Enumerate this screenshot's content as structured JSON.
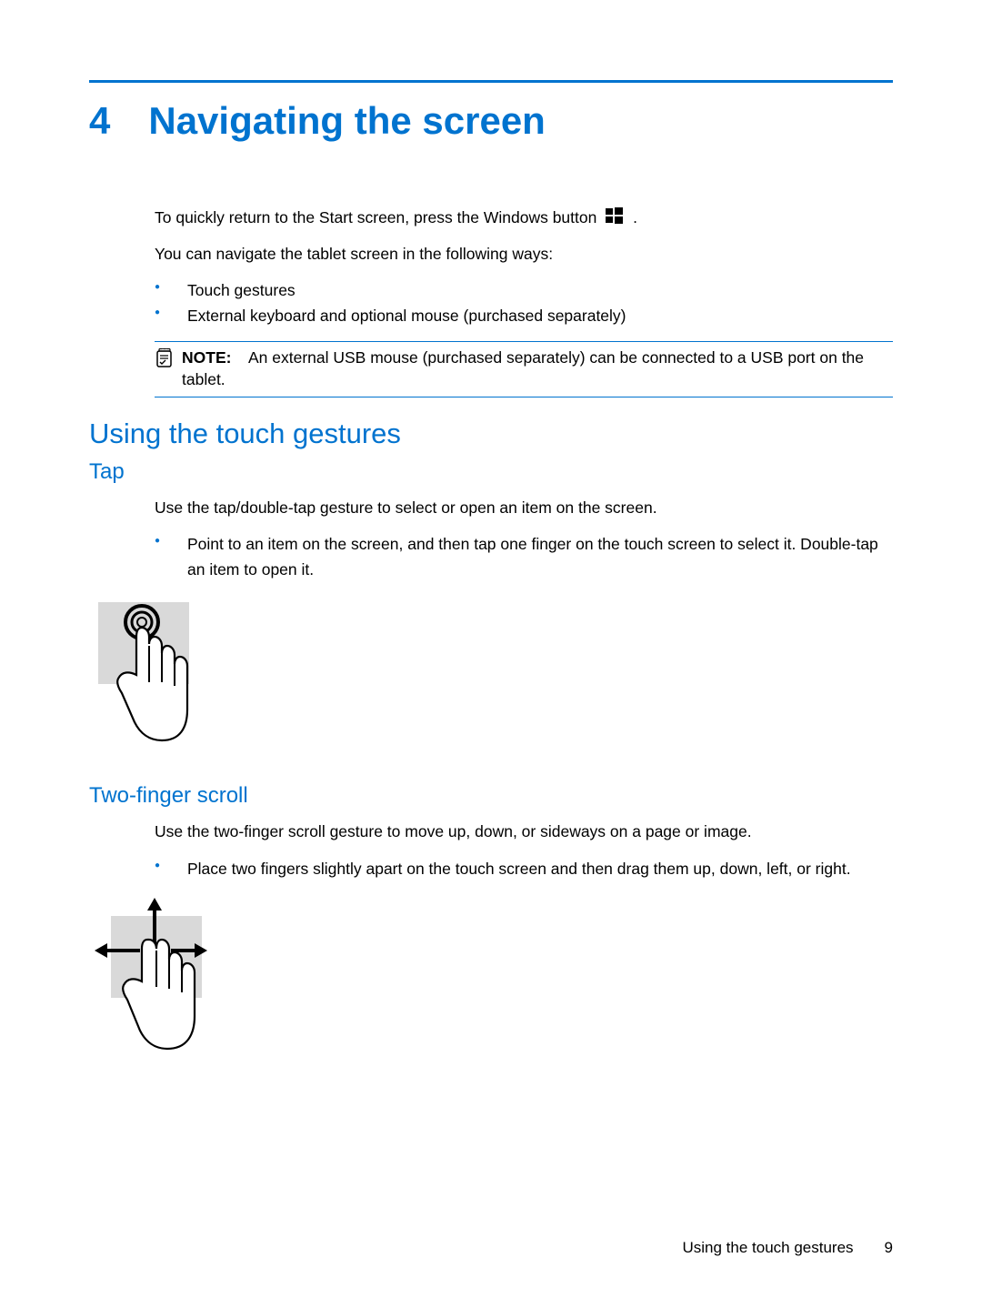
{
  "chapter": {
    "number": "4",
    "title": "Navigating the screen"
  },
  "intro": {
    "p1_pre": "To quickly return to the Start screen, press the Windows button",
    "p1_post": ".",
    "p2": "You can navigate the tablet screen in the following ways:",
    "bullets": [
      "Touch gestures",
      "External keyboard and optional mouse (purchased separately)"
    ]
  },
  "note": {
    "label": "NOTE:",
    "text": "An external USB mouse (purchased separately) can be connected to a USB port on the tablet."
  },
  "section1": {
    "title": "Using the touch gestures"
  },
  "tap": {
    "title": "Tap",
    "p1": "Use the tap/double-tap gesture to select or open an item on the screen.",
    "bullet": "Point to an item on the screen, and then tap one finger on the touch screen to select it. Double-tap an item to open it."
  },
  "scroll": {
    "title": "Two-finger scroll",
    "p1": "Use the two-finger scroll gesture to move up, down, or sideways on a page or image.",
    "bullet": "Place two fingers slightly apart on the touch screen and then drag them up, down, left, or right."
  },
  "footer": {
    "text": "Using the touch gestures",
    "page": "9"
  }
}
